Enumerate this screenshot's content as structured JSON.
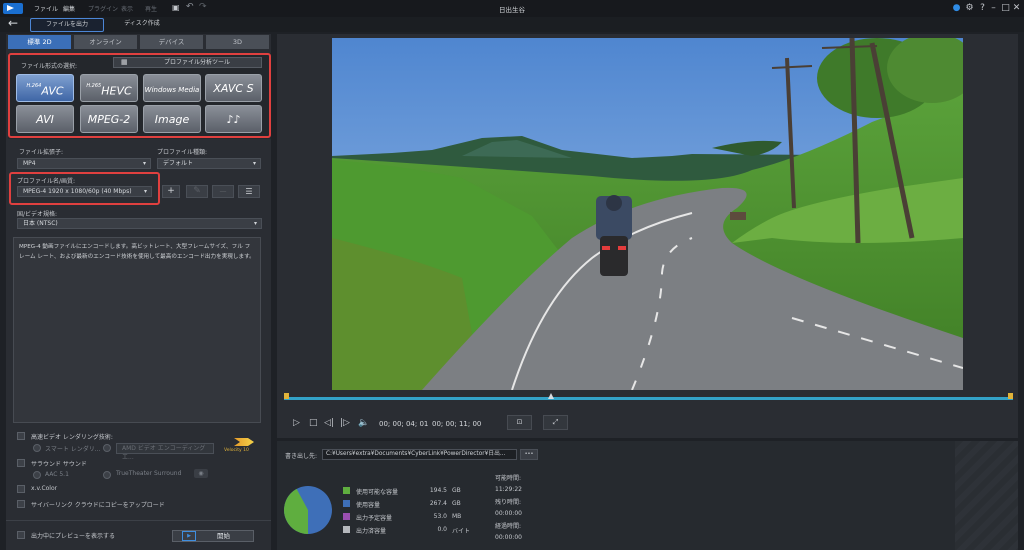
{
  "app": {
    "title": "日出生谷",
    "menu": [
      "ファイル",
      "編集",
      "プラグイン",
      "表示",
      "再生"
    ],
    "mode_tabs": [
      "ファイルを出力",
      "ディスク作成"
    ]
  },
  "output_tabs": [
    "標準 2D",
    "オンライン",
    "デバイス",
    "3D"
  ],
  "format": {
    "section_label": "ファイル形式の選択:",
    "profile_tool_label": "プロファイル分析ツール",
    "buttons": [
      {
        "label": "AVC",
        "sup": "H.264"
      },
      {
        "label": "HEVC",
        "sup": "H.265"
      },
      {
        "label": "Windows Media",
        "sup": ""
      },
      {
        "label": "XAVC S",
        "sup": ""
      },
      {
        "label": "AVI",
        "sup": ""
      },
      {
        "label": "MPEG-2",
        "sup": ""
      },
      {
        "label": "Image",
        "sup": ""
      },
      {
        "label": "♪♪",
        "sup": ""
      }
    ],
    "selected_index": 0
  },
  "settings": {
    "extension_label": "ファイル拡張子:",
    "extension_value": "MP4",
    "profile_type_label": "プロファイル種類:",
    "profile_type_value": "デフォルト",
    "profile_name_label": "プロファイル名/画質:",
    "profile_name_value": "MPEG-4 1920 x 1080/60p (40 Mbps)",
    "add_symbol": "+",
    "remove_symbol": "—",
    "standard_label": "国/ビデオ規格:",
    "standard_value": "日本 (NTSC)",
    "description": "MPEG-4 動画ファイルにエンコードします。高ビットレート、大型フレームサイズ、フル フレーム レート、および最新のエンコード技術を使用して最高のエンコード出力を実現します。"
  },
  "options": {
    "fast_render": "高速ビデオ レンダリング技術:",
    "smart_render": "スマート レンダリ...",
    "hw_encode": "AMD ビデオ エンコーディング エ...",
    "surround": "サラウンド サウンド",
    "aac": "AAC 5.1",
    "truetheater": "TrueTheater Surround",
    "xvcolor": "x.v.Color",
    "cyberlink_cloud": "サイバーリンク クラウドにコピーをアップロード",
    "preview_during_output": "出力中にプレビューを表示する",
    "start": "開始",
    "velocity_badge": "Velocity 10"
  },
  "playback": {
    "timecode_current": "00; 00; 04; 01",
    "timecode_total": "00; 00; 11; 00"
  },
  "output_info": {
    "path_label": "書き出し先:",
    "path_value": "C:¥Users¥extra¥Documents¥CyberLink¥PowerDirector¥日出...",
    "browse": "•••",
    "disk": [
      {
        "label": "使用可能な容量",
        "value": "194.5",
        "unit": "GB",
        "color": "#5fae3f"
      },
      {
        "label": "使用容量",
        "value": "267.4",
        "unit": "GB",
        "color": "#3e6fb8"
      },
      {
        "label": "出力予定容量",
        "value": "53.0",
        "unit": "MB",
        "color": "#9a4fb0"
      },
      {
        "label": "出力済容量",
        "value": "0.0",
        "unit": "バイト",
        "color": "#b5b8bd"
      }
    ],
    "estimated_label": "可能時間:",
    "estimated_value": "11:29:22",
    "remaining_label": "残り時間:",
    "remaining_value": "00:00:00",
    "elapsed_label": "経過時間:",
    "elapsed_value": "00:00:00"
  },
  "colors": {
    "accent": "#3b6fb8",
    "highlight_box": "#e0403f",
    "timeline": "#33a2c8"
  }
}
